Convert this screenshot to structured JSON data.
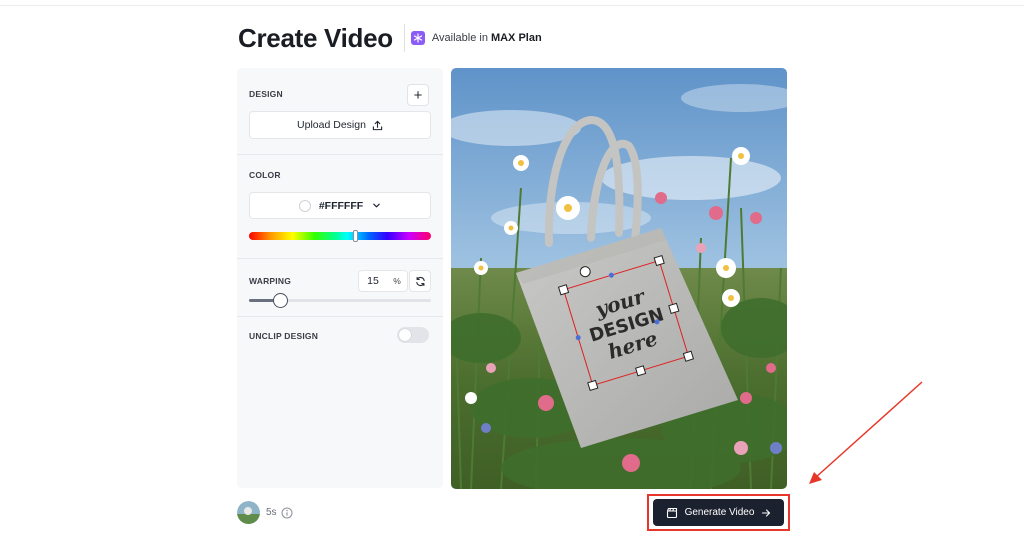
{
  "header": {
    "title": "Create Video",
    "plan_prefix": "Available in",
    "plan_name": "MAX Plan",
    "plan_icon": "snowflake-icon"
  },
  "panel": {
    "design": {
      "label": "DESIGN",
      "add_icon": "+",
      "upload_label": "Upload Design",
      "upload_icon": "upload-icon"
    },
    "color": {
      "label": "COLOR",
      "value": "#FFFFFF",
      "hue_position": 0.58
    },
    "warping": {
      "label": "WARPING",
      "value": "15",
      "unit": "%",
      "slider_fraction": 0.17
    },
    "unclip": {
      "label": "UNCLIP DESIGN",
      "enabled": false
    }
  },
  "preview": {
    "design_text_1": "your",
    "design_text_2": "DESIGN",
    "design_text_3": "here"
  },
  "footer": {
    "duration": "5s",
    "generate_label": "Generate Video",
    "generate_icon": "clapperboard-icon"
  },
  "colors": {
    "primary_button": "#1c2130",
    "annotation": "#e8372a",
    "plan_badge": "#8b5cf6"
  }
}
